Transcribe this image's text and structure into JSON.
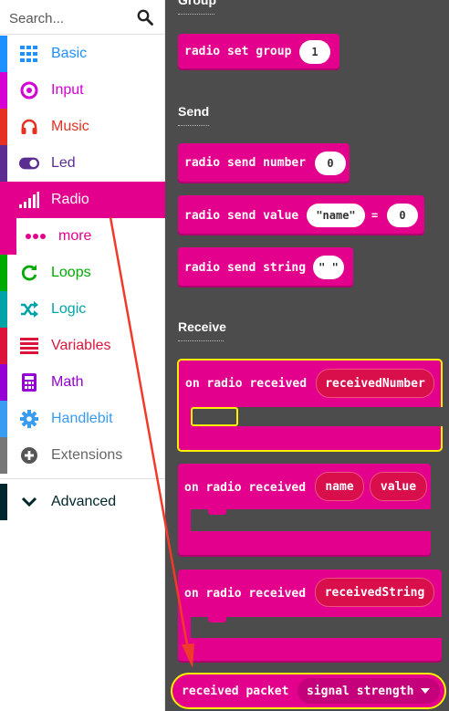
{
  "search": {
    "placeholder": "Search..."
  },
  "colors": {
    "basic": "#1e90ff",
    "input": "#d400d4",
    "music": "#e63022",
    "led": "#5c2d91",
    "radio": "#e3008c",
    "loops": "#00aa00",
    "logic": "#00a4a6",
    "variables": "#dc143c",
    "math": "#9400d3",
    "handlebit": "#3a9cf0",
    "extensions": "#777777",
    "advanced": "#00272b",
    "workspace": "#4c4c4c",
    "block": "#e3008c",
    "variable_pill": "#d90f4c",
    "highlight": "#ffef00"
  },
  "toolbox": {
    "categories": [
      {
        "label": "Basic",
        "icon": "grid-icon"
      },
      {
        "label": "Input",
        "icon": "circle-dot-icon"
      },
      {
        "label": "Music",
        "icon": "headphones-icon"
      },
      {
        "label": "Led",
        "icon": "toggle-icon"
      },
      {
        "label": "Radio",
        "icon": "signal-bars-icon",
        "selected": true
      },
      {
        "label": "Loops",
        "icon": "refresh-icon"
      },
      {
        "label": "Logic",
        "icon": "shuffle-icon"
      },
      {
        "label": "Variables",
        "icon": "list-icon"
      },
      {
        "label": "Math",
        "icon": "calculator-icon"
      },
      {
        "label": "Handlebit",
        "icon": "gear-icon"
      },
      {
        "label": "Extensions",
        "icon": "plus-circle-icon"
      }
    ],
    "more": {
      "label": "more",
      "icon": "more-dots-icon"
    },
    "advanced": {
      "label": "Advanced",
      "icon": "chevron-down-icon"
    }
  },
  "workspace": {
    "group_label": "Group",
    "send_label": "Send",
    "receive_label": "Receive",
    "blocks": {
      "set_group": {
        "text": "radio set group",
        "value": "1"
      },
      "send_number": {
        "text": "radio send number",
        "value": "0"
      },
      "send_value": {
        "text": "radio send value",
        "name": "\"name\"",
        "eq": "=",
        "value": "0"
      },
      "send_string": {
        "text": "radio send string",
        "value": "\" \""
      },
      "recv_number": {
        "text": "on radio received",
        "param": "receivedNumber"
      },
      "recv_value": {
        "text": "on radio received",
        "param1": "name",
        "param2": "value"
      },
      "recv_string": {
        "text": "on radio received",
        "param": "receivedString"
      },
      "packet": {
        "text": "received packet",
        "dropdown": "signal strength"
      }
    }
  }
}
